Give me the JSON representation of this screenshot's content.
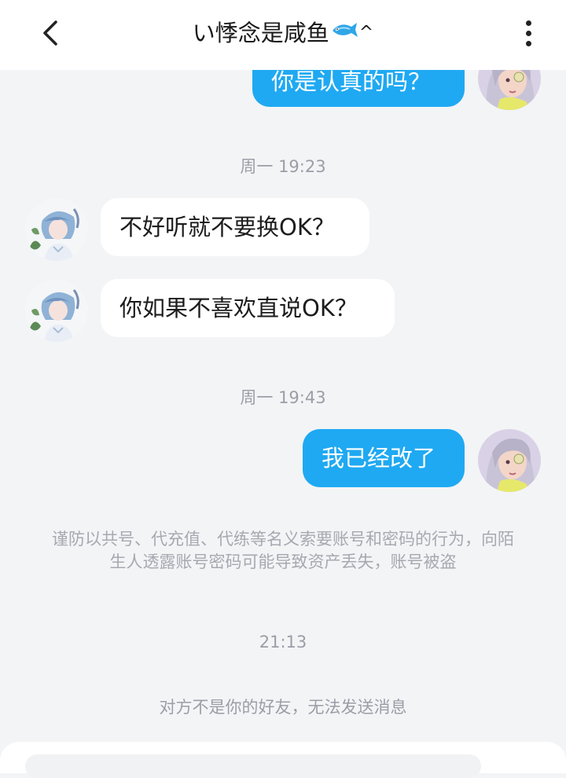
{
  "header": {
    "title": "い悸念是咸鱼",
    "title_suffix": "^",
    "back_icon": "chevron-left-icon",
    "more_icon": "more-vertical-icon"
  },
  "messages": {
    "m1": "你是认真的吗？",
    "t1": "周一 19:23",
    "m2": "不好听就不要换OK？",
    "m3": "你如果不喜欢直说OK？",
    "t2": "周一 19:43",
    "m4": "我已经改了",
    "notice": "谨防以共号、代充值、代练等名义索要账号和密码的行为，向陌生人透露账号密码可能导致资产丢失，账号被盗",
    "t3": "21:13",
    "status": "对方不是你的好友，无法发送消息"
  },
  "colors": {
    "outgoing_bubble": "#1fa9f2",
    "incoming_bubble": "#ffffff",
    "background": "#f3f4f6"
  }
}
